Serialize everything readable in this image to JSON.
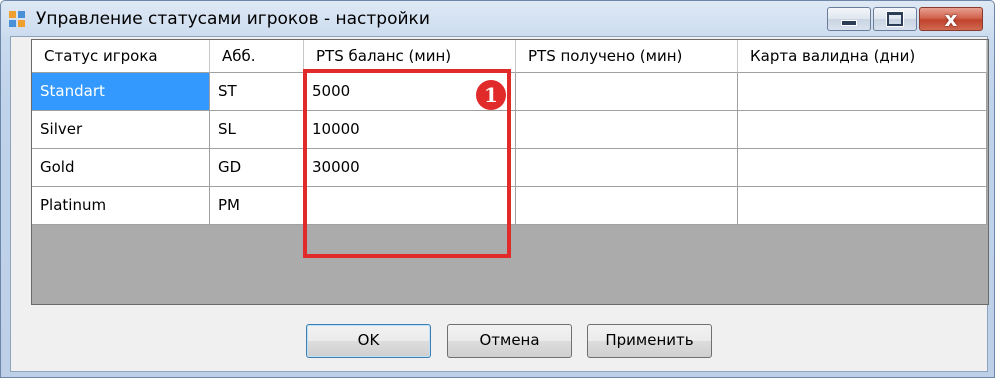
{
  "window": {
    "title": "Управление статусами игроков - настройки",
    "controls": {
      "minimize_icon": "minimize-icon",
      "maximize_icon": "maximize-icon",
      "close_icon": "close-icon",
      "close_glyph": "x"
    }
  },
  "grid": {
    "columns": [
      "Статус игрока",
      "Абб.",
      "PTS баланс (мин)",
      "PTS получено (мин)",
      "Карта валидна (дни)"
    ],
    "rows": [
      {
        "status": "Standart",
        "abbr": "ST",
        "pts_balance": "5000",
        "pts_received": "",
        "card_days": "",
        "selected": true
      },
      {
        "status": "Silver",
        "abbr": "SL",
        "pts_balance": "10000",
        "pts_received": "",
        "card_days": ""
      },
      {
        "status": "Gold",
        "abbr": "GD",
        "pts_balance": "30000",
        "pts_received": "",
        "card_days": ""
      },
      {
        "status": "Platinum",
        "abbr": "PM",
        "pts_balance": "",
        "pts_received": "",
        "card_days": ""
      }
    ]
  },
  "annotation": {
    "number": "1",
    "color": "#e12a2a"
  },
  "buttons": {
    "ok": "OK",
    "cancel": "Отмена",
    "apply": "Применить"
  },
  "colors": {
    "selection": "#3399ff",
    "grid_background": "#ababab",
    "title_gradient": "#c9daee"
  }
}
